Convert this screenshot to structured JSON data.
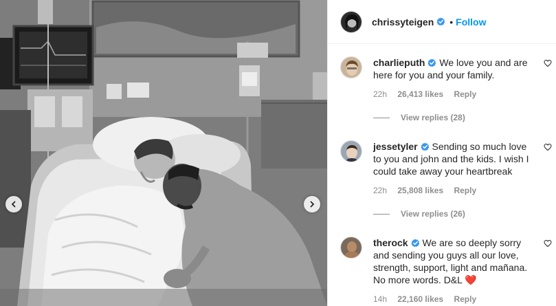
{
  "post": {
    "author": "chrissyteigen",
    "separator": "•",
    "follow_label": "Follow"
  },
  "comments": [
    {
      "user": "charlieputh",
      "text": "We love you and are here for you and your family.",
      "time": "22h",
      "likes": "26,413 likes",
      "reply_label": "Reply",
      "view_replies": "View replies (28)"
    },
    {
      "user": "jessetyler",
      "text": "Sending so much love to you and john and the kids. I wish I could take away your heartbreak",
      "time": "22h",
      "likes": "25,808 likes",
      "reply_label": "Reply",
      "view_replies": "View replies (26)"
    },
    {
      "user": "therock",
      "text": "We are so deeply sorry and sending you guys all our love, strength, support, light and mañana. No more words. D&L",
      "emoji": "❤️",
      "time": "14h",
      "likes": "22,160 likes",
      "reply_label": "Reply"
    }
  ],
  "icons": {
    "verified": "verified-badge-icon",
    "like": "heart-outline-icon",
    "prev": "chevron-left-icon",
    "next": "chevron-right-icon"
  },
  "colors": {
    "accent": "#0095f6",
    "verified": "#3897f0",
    "muted": "#8e8e8e",
    "text": "#262626"
  }
}
